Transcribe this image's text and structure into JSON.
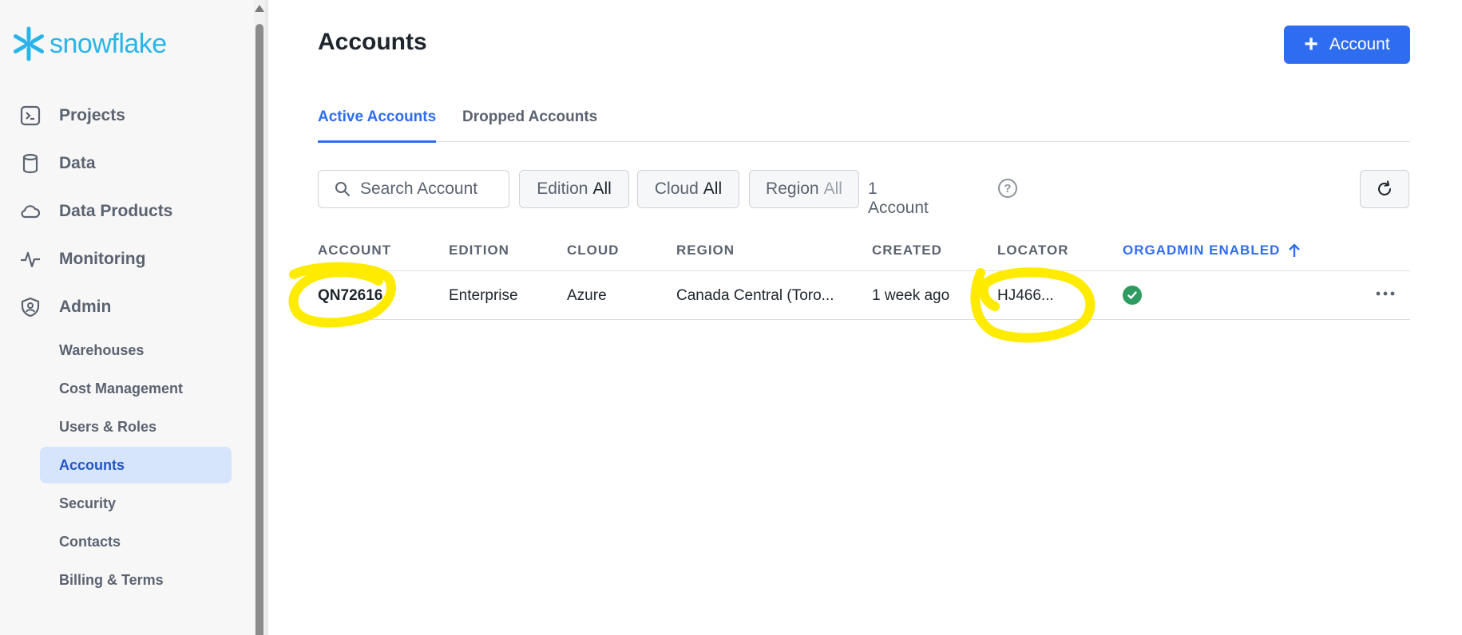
{
  "brand": {
    "name": "snowflake",
    "color": "#29b5e8"
  },
  "sidebar": {
    "items": [
      {
        "label": "Projects",
        "icon": "terminal-icon"
      },
      {
        "label": "Data",
        "icon": "database-icon"
      },
      {
        "label": "Data Products",
        "icon": "cloud-icon"
      },
      {
        "label": "Monitoring",
        "icon": "activity-icon"
      },
      {
        "label": "Admin",
        "icon": "shield-user-icon"
      }
    ],
    "admin_sub": [
      {
        "label": "Warehouses"
      },
      {
        "label": "Cost Management"
      },
      {
        "label": "Users & Roles"
      },
      {
        "label": "Accounts",
        "active": true
      },
      {
        "label": "Security"
      },
      {
        "label": "Contacts"
      },
      {
        "label": "Billing & Terms"
      }
    ]
  },
  "main": {
    "title": "Accounts",
    "add_button": {
      "plus": "+",
      "label": "Account"
    },
    "tabs": [
      {
        "label": "Active Accounts",
        "active": true
      },
      {
        "label": "Dropped Accounts"
      }
    ],
    "toolbar": {
      "search_placeholder": "Search Account",
      "filters": [
        {
          "key": "Edition",
          "value": "All"
        },
        {
          "key": "Cloud",
          "value": "All"
        },
        {
          "key": "Region",
          "value": "All"
        }
      ],
      "count": "1 Account",
      "help": "?"
    },
    "table": {
      "columns": [
        "ACCOUNT",
        "EDITION",
        "CLOUD",
        "REGION",
        "CREATED",
        "LOCATOR",
        "ORGADMIN ENABLED"
      ],
      "sort_column": "ORGADMIN ENABLED",
      "sort_direction": "ascending",
      "rows": [
        {
          "account": "QN72616",
          "edition": "Enterprise",
          "cloud": "Azure",
          "region": "Canada Central (Toro...",
          "created": "1 week ago",
          "locator": "HJ466...",
          "orgadmin_enabled": true
        }
      ]
    }
  },
  "colors": {
    "accent": "#2f6df0",
    "active_nav_bg": "#d6e4fc",
    "success": "#2e9b61",
    "annotation": "#ffeb00"
  }
}
